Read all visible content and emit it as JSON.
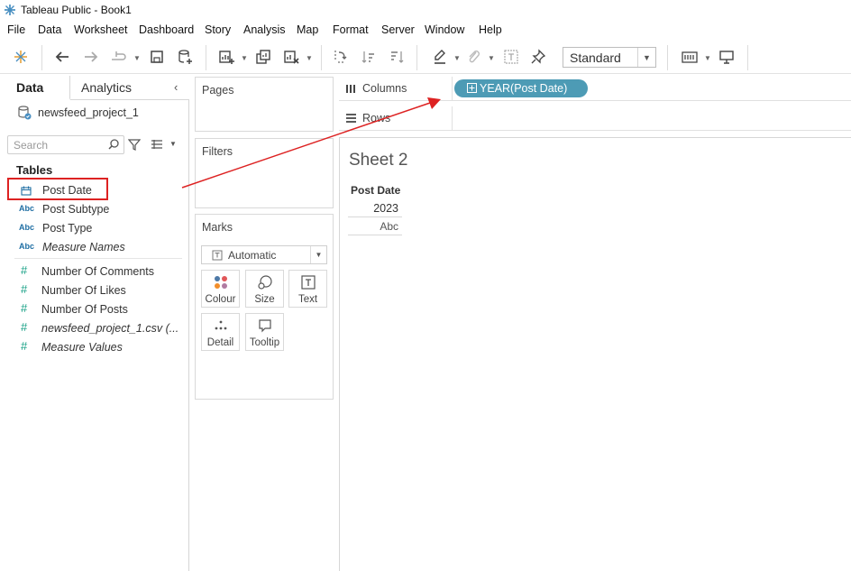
{
  "window": {
    "title": "Tableau Public - Book1"
  },
  "menu": [
    "File",
    "Data",
    "Worksheet",
    "Dashboard",
    "Story",
    "Analysis",
    "Map",
    "Format",
    "Server",
    "Window",
    "Help"
  ],
  "toolbar": {
    "fit_value": "Standard"
  },
  "data_pane": {
    "tabs": {
      "data": "Data",
      "analytics": "Analytics"
    },
    "datasource": "newsfeed_project_1",
    "search_placeholder": "Search",
    "tables_heading": "Tables",
    "dimension_fields": [
      {
        "type": "date",
        "name": "Post Date"
      },
      {
        "type": "Abc",
        "name": "Post Subtype"
      },
      {
        "type": "Abc",
        "name": "Post Type"
      },
      {
        "type": "Abc",
        "name": "Measure Names"
      }
    ],
    "measure_fields": [
      {
        "type": "#",
        "name": "Number Of Comments"
      },
      {
        "type": "#",
        "name": "Number Of Likes"
      },
      {
        "type": "#",
        "name": "Number Of Posts"
      },
      {
        "type": "#",
        "name": "newsfeed_project_1.csv (..."
      },
      {
        "type": "#",
        "name": "Measure Values"
      }
    ]
  },
  "shelves": {
    "pages": "Pages",
    "filters": "Filters",
    "marks": "Marks",
    "marks_type": "Automatic",
    "mark_buttons": [
      "Colour",
      "Size",
      "Text",
      "Detail",
      "Tooltip"
    ],
    "columns": "Columns",
    "rows": "Rows",
    "columns_pill": "YEAR(Post Date)"
  },
  "sheet": {
    "title": "Sheet 2",
    "column_header": "Post Date",
    "year_value": "2023",
    "abc_value": "Abc"
  },
  "colors": {
    "pill": "#4d9bb5",
    "annotation": "#dd2222"
  }
}
